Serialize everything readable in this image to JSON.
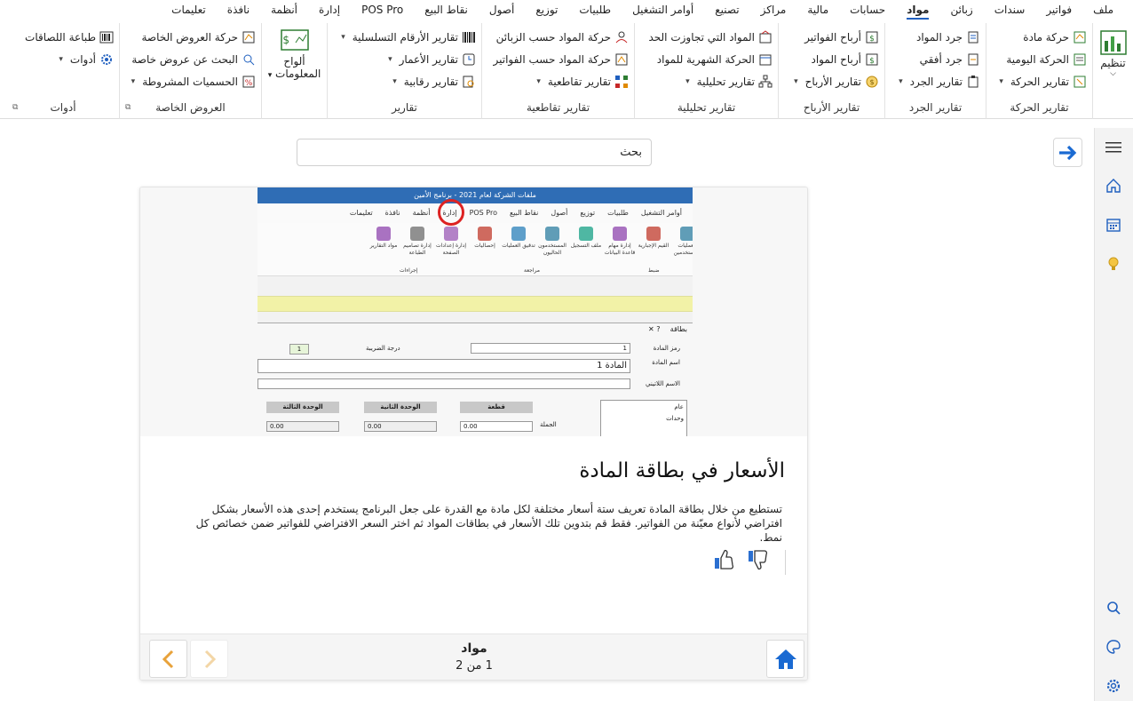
{
  "menu": {
    "items": [
      "ملف",
      "فواتير",
      "سندات",
      "زبائن",
      "مواد",
      "حسابات",
      "مالية",
      "مراكز",
      "تصنيع",
      "أوامر التشغيل",
      "طلبيات",
      "توزيع",
      "أصول",
      "نقاط البيع",
      "POS Pro",
      "إدارة",
      "أنظمة",
      "نافذة",
      "تعليمات"
    ],
    "active": "مواد"
  },
  "ribbon": {
    "organize": {
      "label": "تنظيم"
    },
    "movement": {
      "title": "تقارير الحركة",
      "col1": [
        "حركة مادة",
        "الحركة اليومية",
        "تقارير الحركة"
      ],
      "col2": [
        "جرد المواد",
        "جرد أفقي",
        "تقارير الجرد"
      ]
    },
    "inventory": {
      "title": "تقارير الجرد"
    },
    "profits": {
      "title": "تقارير الأرباح",
      "items": [
        "أرباح الفواتير",
        "أرباح المواد",
        "تقارير الأرباح"
      ]
    },
    "analytic": {
      "title": "تقارير تحليلية",
      "items": [
        "المواد التي تجاوزت الحد",
        "الحركة الشهرية للمواد",
        "تقارير تحليلية"
      ]
    },
    "cross": {
      "title": "تقارير تقاطعية",
      "items": [
        "حركة المواد حسب الزبائن",
        "حركة المواد حسب الفواتير",
        "تقارير تقاطعية"
      ]
    },
    "reports": {
      "title": "تقارير",
      "items": [
        "تقارير الأرقام التسلسلية",
        "تقارير الأعمار",
        "تقارير رقابية"
      ]
    },
    "boards": {
      "label_line1": "ألواح",
      "label_line2": "المعلومات"
    },
    "offers": {
      "title": "العروض  الخاصة",
      "items": [
        "حركة العروض الخاصة",
        "البحث عن عروض خاصة",
        "الحسميات المشروطة"
      ]
    },
    "tools": {
      "title": "أدوات",
      "items": [
        "طباعة اللصاقات",
        "أدوات"
      ]
    }
  },
  "search": {
    "value": "بحث"
  },
  "card": {
    "title": "الأسعار في بطاقة المادة",
    "description": "تستطيع من خلال بطاقة المادة تعريف ستة أسعار مختلفة لكل مادة مع القدرة على جعل البرنامج يستخدم إحدى هذه الأسعار بشكل افتراضي لأنواع معيّنة من الفواتير. فقط قم بتدوين تلك الأسعار في بطاقات المواد ثم اختر السعر الافتراضي للفواتير ضمن خصائص كل نمط.",
    "footer_title": "مواد",
    "page_info": "1 من 2"
  },
  "inner_shot": {
    "title": "ملفات الشركة لعام 2021 - برنامج الأمين",
    "menu": [
      "تعليمات",
      "نافذة",
      "أنظمة",
      "إدارة",
      "POS Pro",
      "نقاط البيع",
      "أصول",
      "توزيع",
      "طلبيات",
      "أوامر التشغيل"
    ],
    "ribbon_items": [
      "مواد التقارير",
      "إدارة تصاميم الطباعة",
      "إدارة إعدادات الصفحة",
      "إحصاليات",
      "تدقيق العمليات",
      "المستخدمون الحاليون",
      "ملف التسجيل",
      "إدارة مهام قاعدة البيانات",
      "القيم الإجبارية",
      "العمليات المستخدمين"
    ],
    "ribbon_groups": [
      "إجراءات",
      "مراجعة",
      "ضبط"
    ],
    "dialog_title": "بطاقة",
    "code_label": "رمز المادة",
    "code_value": "1",
    "name_label": "اسم المادة",
    "name_value": "المادة 1",
    "latin_label": "الاسم اللاتيني",
    "tax_label": "درجة الضريبة",
    "nav_value": "1",
    "unit1": "قطعة",
    "unit2": "الوحدة الثانية",
    "unit3": "الوحدة الثالثة",
    "price_label": "الجملة",
    "price1": "0.00",
    "price2": "0.00",
    "price3": "0.00",
    "list": [
      "عام",
      "وحدات"
    ]
  },
  "colors": {
    "accent": "#1f5fbf",
    "nav_arrow": "#e8a23a",
    "home": "#1a6ad2"
  }
}
